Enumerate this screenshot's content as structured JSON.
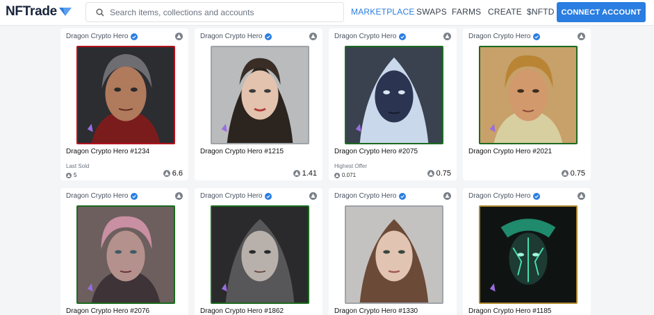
{
  "header": {
    "logo_text": "NFTrade",
    "search_placeholder": "Search items, collections and accounts",
    "nav": [
      "MARKETPLACE",
      "SWAPS",
      "FARMS",
      "CREATE",
      "$NFTD"
    ],
    "connect_label": "CONNECT ACCOUNT"
  },
  "colors": {
    "accent": "#2a7de1",
    "border_red": "#b3121d",
    "border_green": "#1c6b1f",
    "border_gray": "#9ea3a8",
    "border_gold": "#b08a2e"
  },
  "cards": [
    {
      "collection": "Dragon Crypto Hero",
      "name": "Dragon Crypto Hero #1234",
      "label": "Last Sold",
      "small_value": "5",
      "price": "6.6"
    },
    {
      "collection": "Dragon Crypto Hero",
      "name": "Dragon Crypto Hero #1215",
      "label": "",
      "small_value": "",
      "price": "1.41"
    },
    {
      "collection": "Dragon Crypto Hero",
      "name": "Dragon Crypto Hero #2075",
      "label": "Highest Offer",
      "small_value": "0.071",
      "price": "0.75"
    },
    {
      "collection": "Dragon Crypto Hero",
      "name": "Dragon Crypto Hero #2021",
      "label": "",
      "small_value": "",
      "price": "0.75"
    },
    {
      "collection": "Dragon Crypto Hero",
      "name": "Dragon Crypto Hero #2076"
    },
    {
      "collection": "Dragon Crypto Hero",
      "name": "Dragon Crypto Hero #1862"
    },
    {
      "collection": "Dragon Crypto Hero",
      "name": "Dragon Crypto Hero #1330"
    },
    {
      "collection": "Dragon Crypto Hero",
      "name": "Dragon Crypto Hero #1185"
    }
  ],
  "icons": {
    "search": "search-icon",
    "verified": "verified-badge-icon",
    "chain": "blockchain-icon",
    "currency": "currency-icon"
  }
}
